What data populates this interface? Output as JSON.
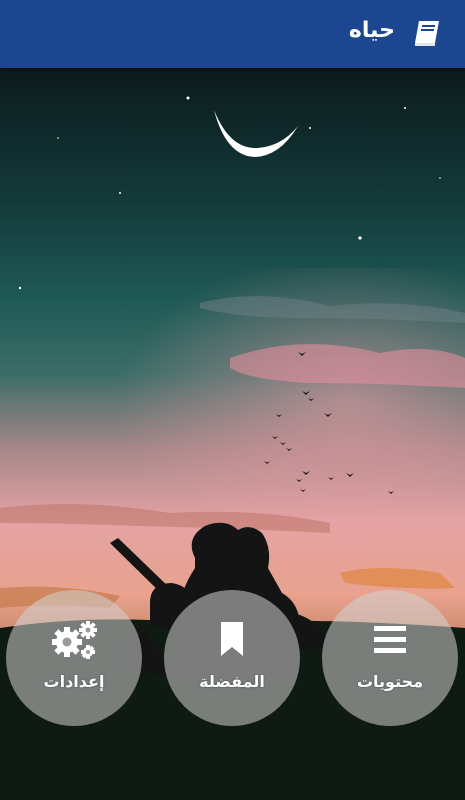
{
  "app": {
    "title": "حياه",
    "icon": "book-icon",
    "header_color": "#1d4690"
  },
  "buttons": [
    {
      "label": "محتويات",
      "icon": "menu-lines-icon"
    },
    {
      "label": "المفضلة",
      "icon": "bookmark-icon"
    },
    {
      "label": "إعدادات",
      "icon": "gears-icon"
    }
  ],
  "background": {
    "description_icon": "night-sky-couple-guitar-image"
  }
}
